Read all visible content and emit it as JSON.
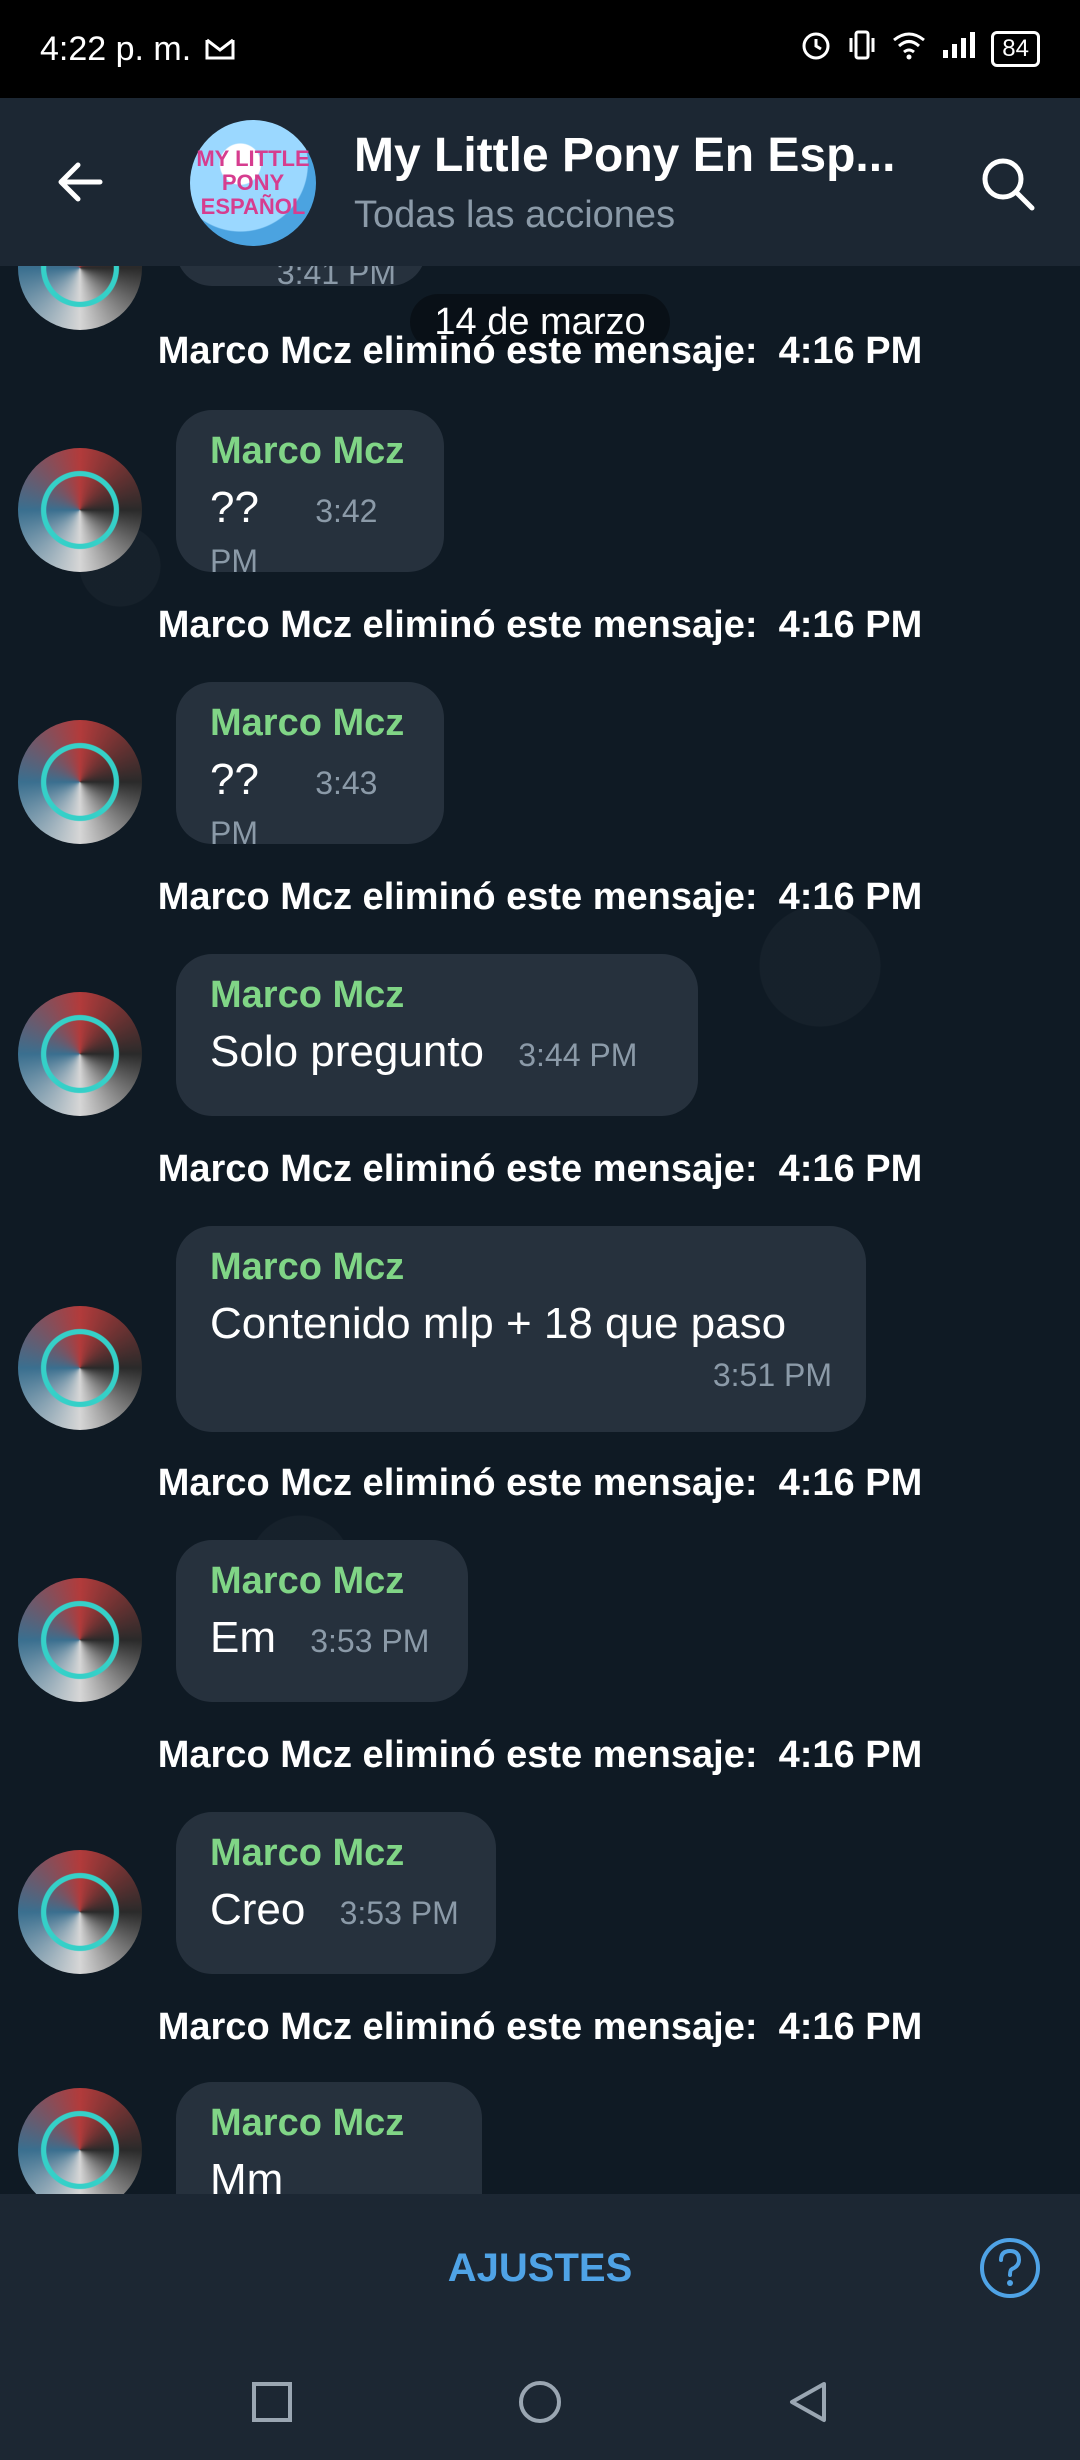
{
  "status_bar": {
    "time": "4:22 p. m.",
    "battery": "84"
  },
  "header": {
    "title": "My Little Pony En Esp...",
    "subtitle": "Todas las acciones",
    "avatar_text": "MY LITTLE PONY ESPAÑOL"
  },
  "chat": {
    "date_pill": "14 de marzo",
    "partial_time": "3:41 PM",
    "service_text": "Marco Mcz eliminó este mensaje:",
    "service_time": "4:16 PM",
    "messages": [
      {
        "sender": "Marco Mcz",
        "text": "??",
        "time": "3:42 PM"
      },
      {
        "sender": "Marco Mcz",
        "text": "??",
        "time": "3:43 PM"
      },
      {
        "sender": "Marco Mcz",
        "text": "Solo pregunto",
        "time": "3:44 PM"
      },
      {
        "sender": "Marco Mcz",
        "text": "Contenido mlp + 18 que paso",
        "time": "3:51 PM"
      },
      {
        "sender": "Marco Mcz",
        "text": "Em",
        "time": "3:53 PM"
      },
      {
        "sender": "Marco Mcz",
        "text": "Creo",
        "time": "3:53 PM"
      },
      {
        "sender": "Marco Mcz",
        "text": "Mm",
        "time": ""
      }
    ]
  },
  "footer": {
    "settings_label": "AJUSTES"
  }
}
